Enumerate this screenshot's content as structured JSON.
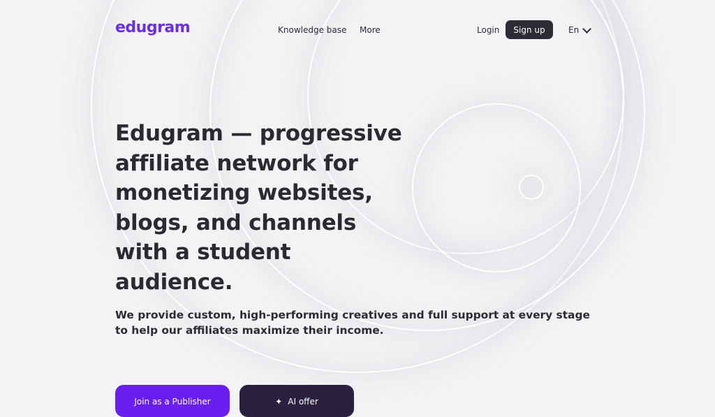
{
  "brand": {
    "logo_text": "edugram",
    "accent": "#6a1ff0"
  },
  "nav": {
    "knowledge_base": "Knowledge base",
    "more": "More",
    "login": "Login",
    "signup": "Sign up",
    "language": "En"
  },
  "hero": {
    "title": "Edugram — progressive affiliate network for monetizing websites, blogs, and channels with a student audience.",
    "subtitle": "We provide custom, high-performing creatives and full support at every stage to help our affiliates maximize their income."
  },
  "actions": {
    "join_publisher": "Join as a Publisher",
    "ai_offer": "AI offer"
  },
  "icons": {
    "language_toggle": "chevron-down-icon",
    "ai_offer": "sparkle-icon"
  }
}
